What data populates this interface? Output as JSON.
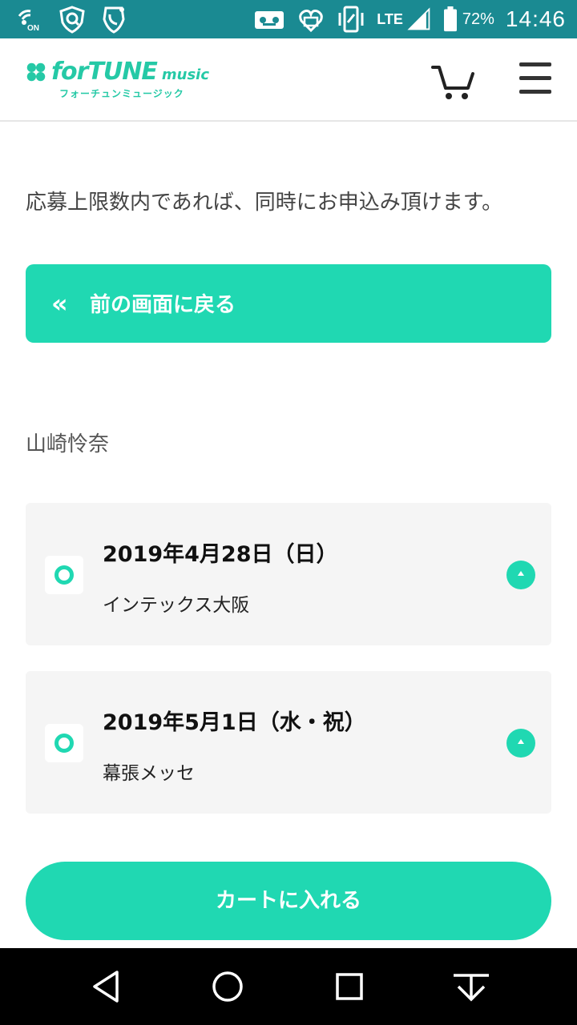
{
  "status_bar": {
    "battery": "72%",
    "time": "14:46",
    "network": "LTE",
    "icons": [
      "nfc-on-icon",
      "shield-icon",
      "call-icon",
      "voicemail-icon",
      "gift-icon",
      "vibrate-icon",
      "signal-icon",
      "battery-icon"
    ]
  },
  "header": {
    "logo_text": "forTUNE",
    "logo_music": "music",
    "logo_sub": "フォーチュンミュージック",
    "icons": [
      "cart-icon",
      "menu-icon"
    ]
  },
  "content": {
    "notice": "応募上限数内であれば、同時にお申込み頂けます。",
    "back_button": {
      "chevron": "«",
      "label": "前の画面に戻る"
    },
    "member_name": "山崎怜奈",
    "events": [
      {
        "date": "2019年4月28日（日）",
        "venue": "インテックス大阪"
      },
      {
        "date": "2019年5月1日（水・祝）",
        "venue": "幕張メッセ"
      }
    ],
    "add_to_cart_label": "カートに入れる"
  },
  "colors": {
    "status_bar": "#1a8a92",
    "accent": "#20d8b2",
    "card_bg": "#f5f5f5"
  }
}
